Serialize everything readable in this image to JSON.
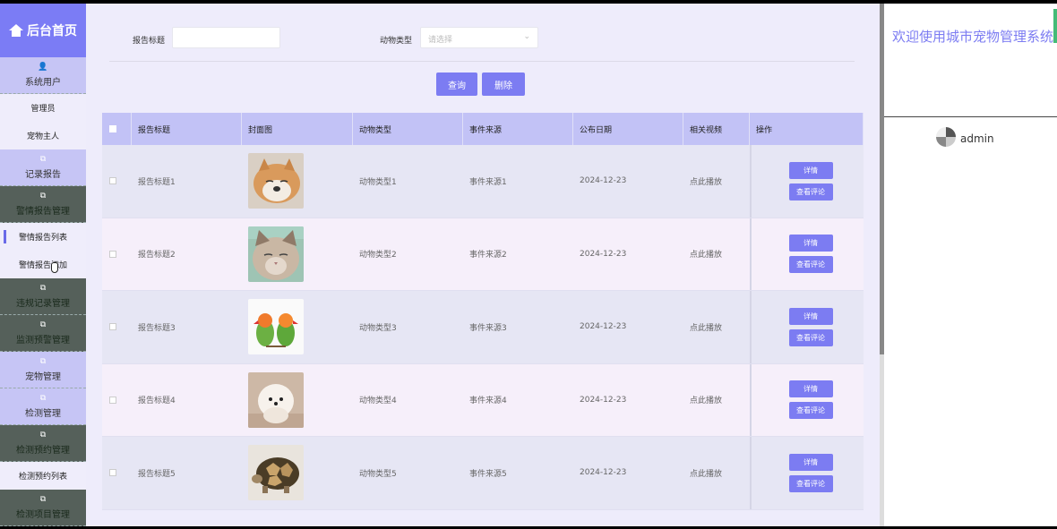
{
  "sidebar": {
    "home": "后台首页",
    "sections": [
      {
        "label": "系统用户",
        "style": "lav"
      },
      {
        "label": "管理员",
        "type": "sub"
      },
      {
        "label": "宠物主人",
        "type": "sub"
      },
      {
        "label": "记录报告",
        "style": "lav"
      },
      {
        "label": "警情报告管理",
        "style": "dark"
      },
      {
        "label": "警情报告列表",
        "type": "sub",
        "active": true
      },
      {
        "label": "警情报告添加",
        "type": "sub"
      },
      {
        "label": "违规记录管理",
        "style": "dark"
      },
      {
        "label": "监测预警管理",
        "style": "dark"
      },
      {
        "label": "宠物管理",
        "style": "lav"
      },
      {
        "label": "检测管理",
        "style": "lav"
      },
      {
        "label": "检测预约管理",
        "style": "dark"
      },
      {
        "label": "检测预约列表",
        "type": "sub"
      },
      {
        "label": "检测项目管理",
        "style": "dark"
      }
    ]
  },
  "search": {
    "title_label": "报告标题",
    "title_value": "",
    "type_label": "动物类型",
    "type_placeholder": "请选择",
    "query_button": "查询",
    "delete_button": "删除"
  },
  "table": {
    "headers": [
      "报告标题",
      "封面图",
      "动物类型",
      "事件来源",
      "公布日期",
      "相关视频",
      "操作"
    ],
    "rows": [
      {
        "title": "报告标题1",
        "cover": "shiba-dog",
        "animal": "动物类型1",
        "source": "事件来源1",
        "date": "2024-12-23",
        "video": "点此播放"
      },
      {
        "title": "报告标题2",
        "cover": "cat",
        "animal": "动物类型2",
        "source": "事件来源2",
        "date": "2024-12-23",
        "video": "点此播放"
      },
      {
        "title": "报告标题3",
        "cover": "parrots",
        "animal": "动物类型3",
        "source": "事件来源3",
        "date": "2024-12-23",
        "video": "点此播放"
      },
      {
        "title": "报告标题4",
        "cover": "pomeranian",
        "animal": "动物类型4",
        "source": "事件来源4",
        "date": "2024-12-23",
        "video": "点此播放"
      },
      {
        "title": "报告标题5",
        "cover": "tortoise",
        "animal": "动物类型5",
        "source": "事件来源5",
        "date": "2024-12-23",
        "video": "点此播放"
      }
    ],
    "detail_button": "详情",
    "comment_button": "查看评论"
  },
  "right_panel": {
    "welcome": "欢迎使用城市宠物管理系统",
    "username": "admin"
  }
}
